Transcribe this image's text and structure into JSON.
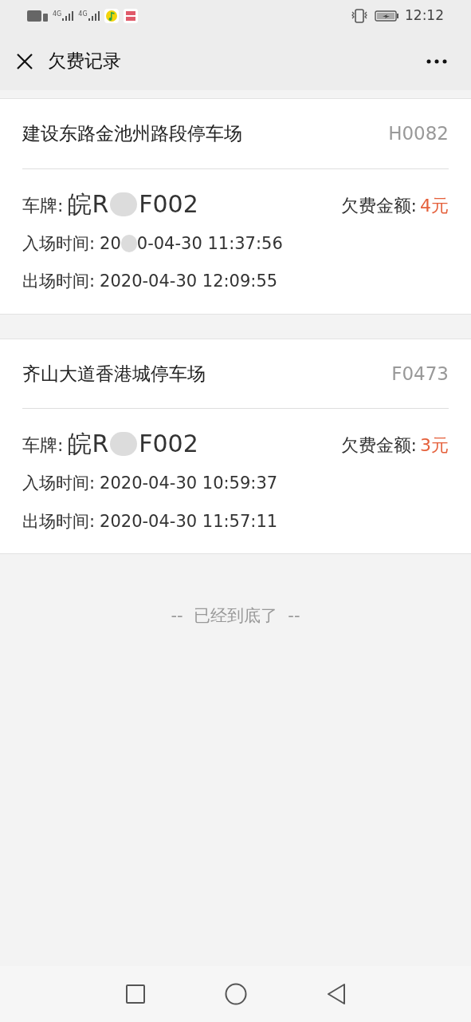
{
  "status_bar": {
    "time": "12:12",
    "network_labels": [
      "4G",
      "4G"
    ]
  },
  "header": {
    "title": "欠费记录"
  },
  "records": [
    {
      "lot": "建设东路金池州路段停车场",
      "code": "H0082",
      "plate_label": "车牌:",
      "plate_parts": [
        "皖R",
        "F002"
      ],
      "amount_label": "欠费金额:",
      "amount": "4元",
      "entry_label": "入场时间:",
      "entry_parts": [
        "20",
        "0-04-30 11:37:56"
      ],
      "exit_label": "出场时间:",
      "exit_parts": [
        "2020-04-30 12:09:55"
      ]
    },
    {
      "lot": "齐山大道香港城停车场",
      "code": "F0473",
      "plate_label": "车牌:",
      "plate_parts": [
        "皖R",
        "F002"
      ],
      "amount_label": "欠费金额:",
      "amount": "3元",
      "entry_label": "入场时间:",
      "entry_parts": [
        "2020-04-30 10:59:37"
      ],
      "exit_label": "出场时间:",
      "exit_parts": [
        "2020-04-30 11:57:11"
      ]
    }
  ],
  "end_note": "--  已经到底了  --"
}
